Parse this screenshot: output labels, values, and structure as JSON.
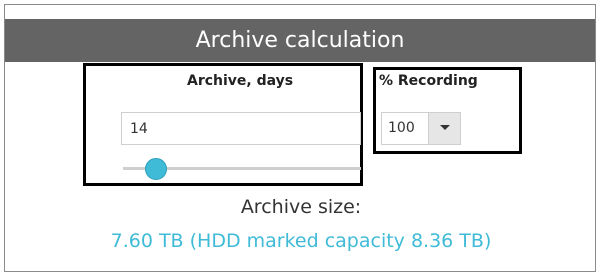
{
  "header": {
    "title": "Archive calculation"
  },
  "archive_days": {
    "label": "Archive, days",
    "value": "14",
    "slider_fraction": 0.1
  },
  "recording": {
    "label": "% Recording",
    "selected": "100"
  },
  "result": {
    "label": "Archive size:",
    "value": "7.60 TB (HDD marked capacity 8.36 TB)"
  },
  "colors": {
    "header_bg": "#646464",
    "accent": "#3fbbd8"
  }
}
